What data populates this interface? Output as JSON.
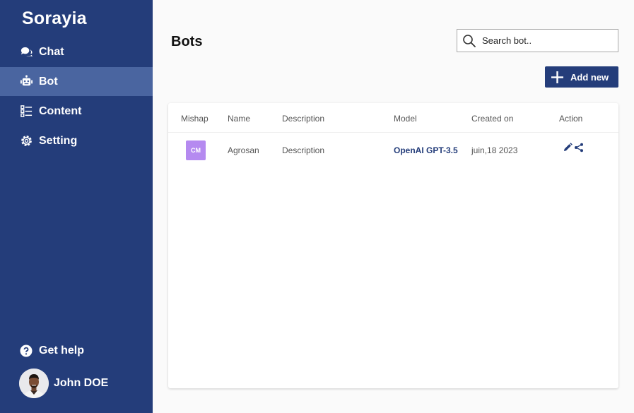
{
  "app": {
    "brand": "Sorayia"
  },
  "sidebar": {
    "items": [
      {
        "label": "Chat",
        "icon": "chat-icon"
      },
      {
        "label": "Bot",
        "icon": "robot-icon",
        "active": true
      },
      {
        "label": "Content",
        "icon": "list-icon"
      },
      {
        "label": "Setting",
        "icon": "gear-icon"
      }
    ],
    "help": {
      "label": "Get help",
      "icon": "help-icon"
    },
    "user": {
      "name": "John DOE"
    }
  },
  "main": {
    "title": "Bots",
    "search": {
      "placeholder": "Search bot.."
    },
    "add_button": "Add new"
  },
  "table": {
    "headers": [
      "Mishap",
      "Name",
      "Description",
      "Model",
      "Created on",
      "Action"
    ],
    "rows": [
      {
        "badge": "CM",
        "name": "Agrosan",
        "description": "Description",
        "model": "OpenAI GPT-3.5",
        "created_on": "juin,18 2023"
      }
    ]
  },
  "colors": {
    "sidebar": "#243d7a",
    "active": "#4a65a0",
    "accent": "#243d7a",
    "badge": "#b58af0"
  }
}
